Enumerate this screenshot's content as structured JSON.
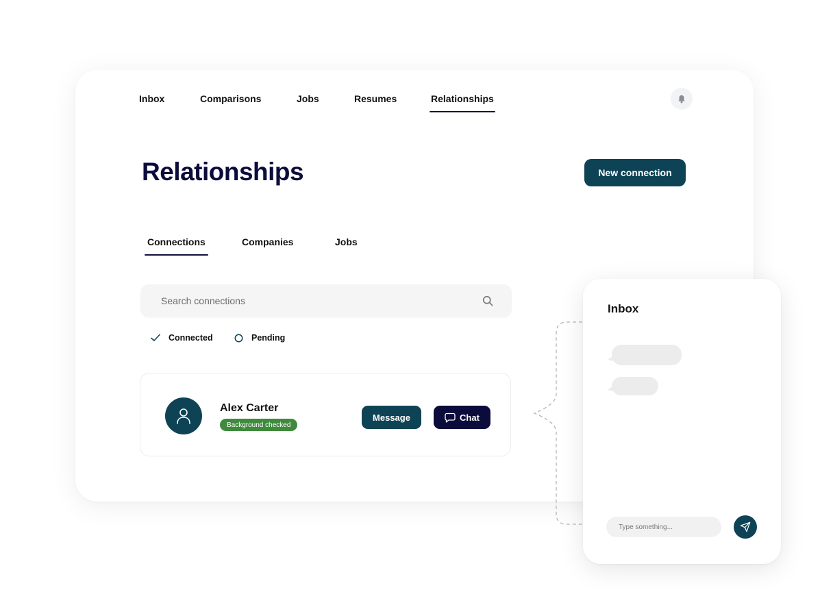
{
  "nav": {
    "items": [
      {
        "label": "Inbox"
      },
      {
        "label": "Comparisons"
      },
      {
        "label": "Jobs"
      },
      {
        "label": "Resumes"
      },
      {
        "label": "Relationships",
        "active": true
      }
    ],
    "notification_icon": "bell-icon"
  },
  "page": {
    "title": "Relationships",
    "new_connection_label": "New connection"
  },
  "tabs": [
    {
      "label": "Connections",
      "active": true
    },
    {
      "label": "Companies"
    },
    {
      "label": "Jobs"
    }
  ],
  "search": {
    "placeholder": "Search connections",
    "value": "",
    "icon": "search-icon"
  },
  "filters": [
    {
      "label": "Connected",
      "icon": "check-icon",
      "selected": true
    },
    {
      "label": "Pending",
      "icon": "circle-icon",
      "selected": false
    }
  ],
  "connection": {
    "name": "Alex Carter",
    "badge": "Background checked",
    "message_label": "Message",
    "chat_label": "Chat",
    "avatar_icon": "user-icon"
  },
  "inbox": {
    "title": "Inbox",
    "input_placeholder": "Type something...",
    "send_icon": "send-icon"
  },
  "colors": {
    "primary": "#0e4355",
    "navy": "#0c0c3c",
    "badge_green": "#3f8a3c",
    "placeholder_bubble": "#ececec"
  }
}
